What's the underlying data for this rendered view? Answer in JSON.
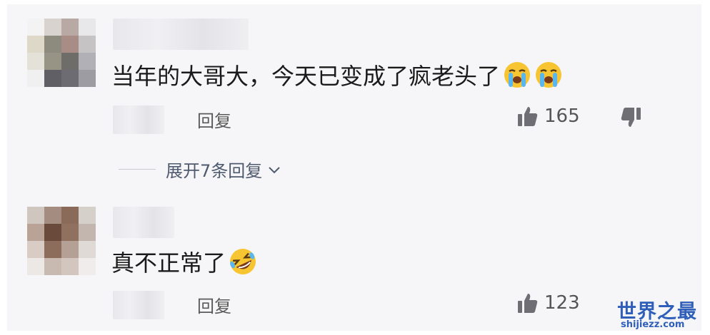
{
  "comments": [
    {
      "text": "当年的大哥大，今天已变成了疯老头了",
      "emojis": [
        "loudly-crying-face",
        "loudly-crying-face"
      ],
      "reply_label": "回复",
      "likes": "165",
      "expand_label": "展开7条回复"
    },
    {
      "text": "真不正常了",
      "emojis": [
        "rolling-on-floor-laughing-face"
      ],
      "reply_label": "回复",
      "likes": "123"
    }
  ],
  "watermark": {
    "title": "世界之最",
    "url": "shijiezz.com",
    "color": "#2f5fb8"
  },
  "colors": {
    "background": "#f6f6f8",
    "comment_text": "#1a1a1a",
    "secondary_text": "#5a5a5a",
    "expand_text": "#4f5a6e"
  }
}
